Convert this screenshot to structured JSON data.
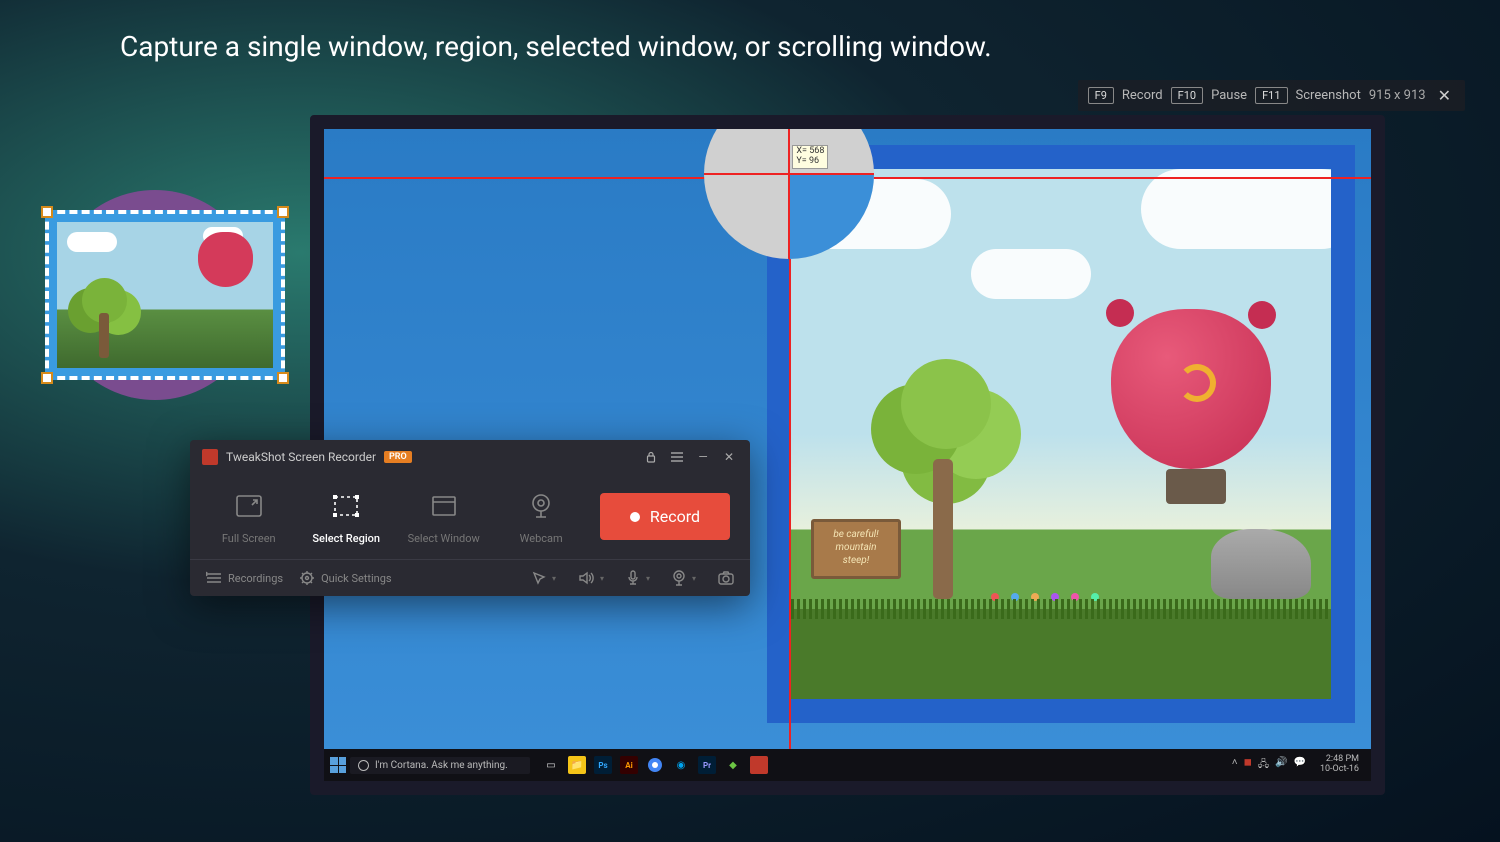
{
  "headline": "Capture a single window, region, selected window, or scrolling window.",
  "top_toolbar": {
    "keys": {
      "record": "F9",
      "pause": "F10",
      "screenshot": "F11"
    },
    "labels": {
      "record": "Record",
      "pause": "Pause",
      "screenshot": "Screenshot"
    },
    "dimensions": "915 x 913",
    "close": "✕"
  },
  "magnifier": {
    "tooltip_line1": "X= 568",
    "tooltip_line2": "Y= 96"
  },
  "wallpaper_sign": {
    "line1": "be careful!",
    "line2": "mountain",
    "line3": "steep!"
  },
  "taskbar": {
    "search_placeholder": "I'm Cortana. Ask me anything.",
    "time": "2:48 PM",
    "date": "10-Oct-16"
  },
  "recorder": {
    "title": "TweakShot Screen Recorder",
    "badge": "PRO",
    "modes": {
      "fullscreen": "Full Screen",
      "region": "Select Region",
      "window": "Select Window",
      "webcam": "Webcam"
    },
    "record_label": "Record",
    "footer": {
      "recordings": "Recordings",
      "quick_settings": "Quick Settings"
    }
  }
}
